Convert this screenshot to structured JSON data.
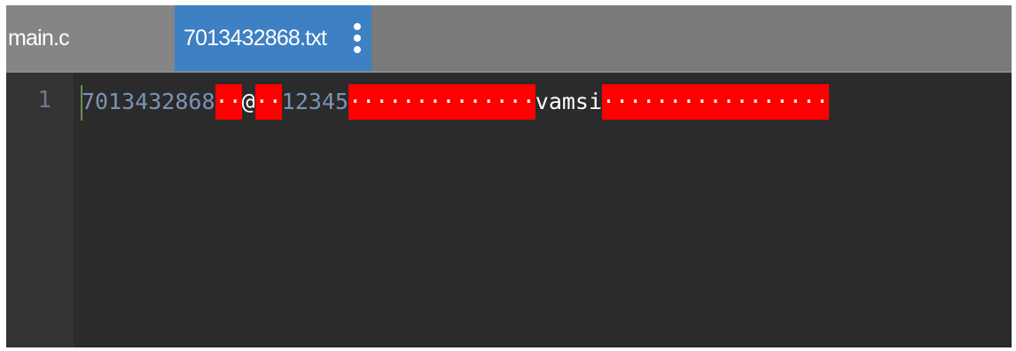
{
  "tabs": [
    {
      "label": "main.c",
      "active": false
    },
    {
      "label": "7013432868.txt",
      "active": true
    }
  ],
  "editor": {
    "line_numbers": [
      "1"
    ],
    "line1": {
      "number": "7013432868",
      "ws1": "··",
      "at": "@",
      "ws2": "··",
      "code": "12345",
      "ws3": "··············",
      "name": "vamsi",
      "ws4": "·················"
    }
  },
  "colors": {
    "tab_bar": "#7a7a7a",
    "active_tab": "#3d80c4",
    "editor_bg": "#2b2b2b",
    "whitespace_highlight": "#ff0000",
    "number_text": "#7b94b4"
  },
  "icons": {
    "tab_menu": "vertical-ellipsis-icon"
  }
}
